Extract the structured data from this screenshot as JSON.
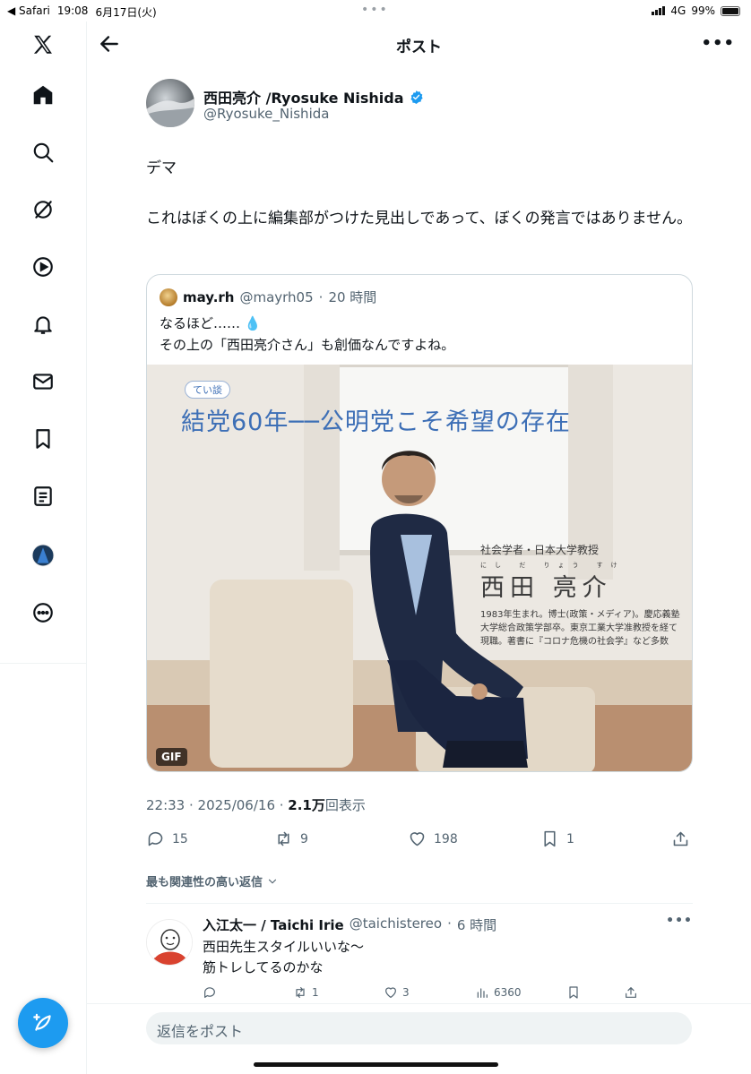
{
  "status_bar": {
    "back_app": "◀ Safari",
    "time": "19:08",
    "date": "6月17日(火)",
    "network": "4G",
    "battery": "99%",
    "battery_level": 0.99
  },
  "sidebar": {
    "items": [
      {
        "icon": "x-logo-icon"
      },
      {
        "icon": "home-icon"
      },
      {
        "icon": "search-icon"
      },
      {
        "icon": "grok-icon"
      },
      {
        "icon": "video-icon"
      },
      {
        "icon": "notifications-icon"
      },
      {
        "icon": "messages-icon"
      },
      {
        "icon": "bookmarks-icon"
      },
      {
        "icon": "lists-icon"
      },
      {
        "icon": "profile-avatar"
      },
      {
        "icon": "more-icon"
      }
    ],
    "compose_icon": "compose-icon"
  },
  "header": {
    "title": "ポスト"
  },
  "post": {
    "author_name": "西田亮介 /Ryosuke Nishida",
    "author_handle": "@Ryosuke_Nishida",
    "text": [
      "デマ",
      "これはぼくの上に編集部がつけた見出しであって、ぼくの発言ではありません。"
    ],
    "timestamp": "22:33 · 2025/06/16 · ",
    "views_count": "2.1万",
    "views_label": "回表示",
    "actions": {
      "replies": "15",
      "reposts": "9",
      "likes": "198",
      "bookmarks": "1"
    }
  },
  "quote": {
    "author_name": "may.rh",
    "author_handle": "@mayrh05",
    "time": "20 時間",
    "text_line1": "なるほど…… ",
    "emoji": "💧",
    "text_line2": "その上の「西田亮介さん」も創価なんですよね。",
    "media": {
      "badge": "GIF",
      "tag": "てい談",
      "headline": "結党60年──公明党こそ希望の存在",
      "role": "社会学者・日本大学教授",
      "ruby": "にし だ りょう すけ",
      "name": "西田 亮介",
      "bio": "1983年生まれ。博士(政策・メディア)。慶応義塾大学総合政策学部卒。東京工業大学准教授を経て現職。著書に『コロナ危機の社会学』など多数"
    }
  },
  "replies_sort": {
    "label": "最も関連性の高い返信"
  },
  "reply": {
    "author_name": "入江太一 / Taichi Irie",
    "author_handle": "@taichistereo",
    "time": "6 時間",
    "text_line1": "西田先生スタイルいいな〜",
    "text_line2": "筋トレしてるのかな",
    "actions": {
      "replies": "",
      "reposts": "1",
      "likes": "3",
      "views": "6360"
    }
  },
  "reply_bar": {
    "placeholder": "返信をポスト"
  },
  "colors": {
    "accent": "#1d9bf0",
    "text": "#0f1419",
    "secondary": "#536471",
    "border": "#cfd9de"
  }
}
